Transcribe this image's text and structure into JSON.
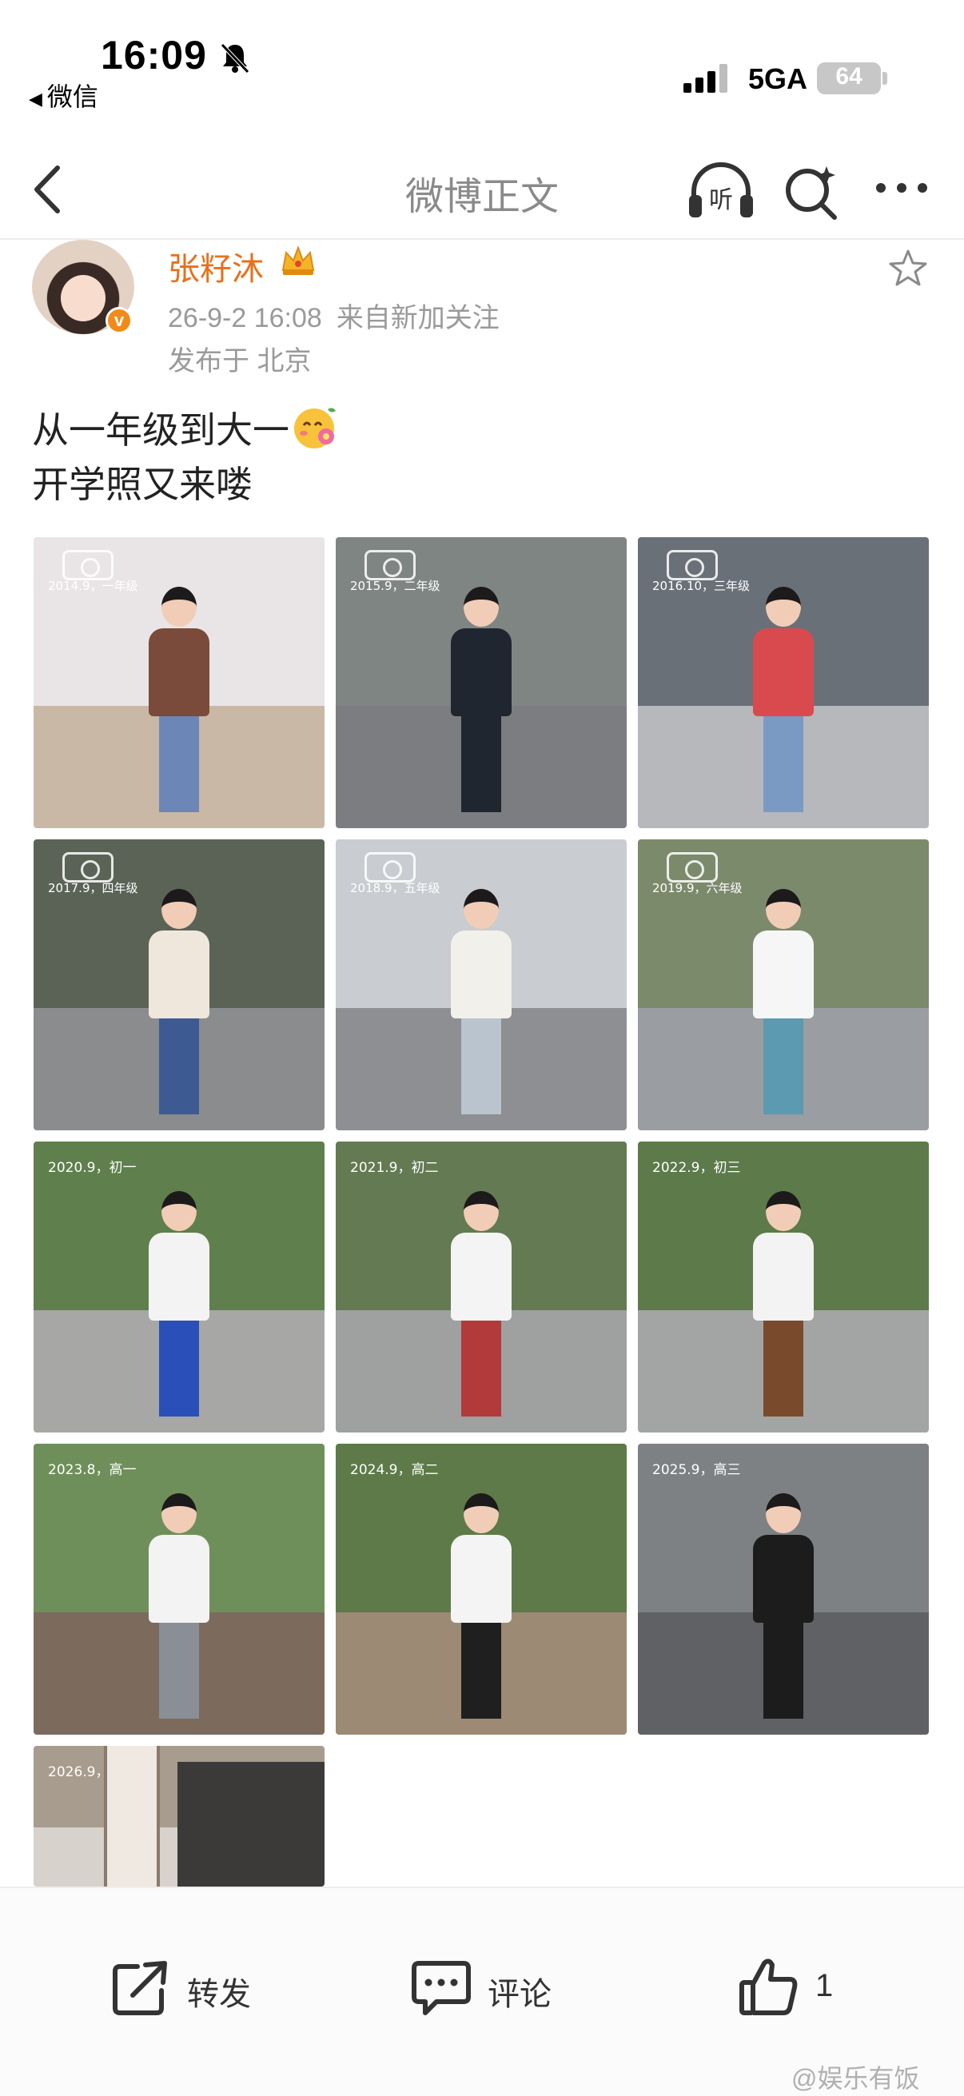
{
  "status_bar": {
    "time": "16:09",
    "back_app": "微信",
    "network": "5GA",
    "battery": "64"
  },
  "nav": {
    "title": "微博正文",
    "listen_icon_label": "听"
  },
  "post": {
    "username": "张籽沐",
    "timestamp": "26-9-2 16:08",
    "source": "来自新加关注",
    "location": "发布于 北京",
    "text_line1": "从一年级到大一",
    "text_line2": "开学照又来喽"
  },
  "photos": [
    {
      "caption": "2014.9，一年级",
      "sky": "#e9e4e6",
      "ground": "#c9b8a6",
      "top": "#7a4b3a",
      "bottom": "#6d86b8"
    },
    {
      "caption": "2015.9，二年级",
      "sky": "#7f8583",
      "ground": "#7b7d80",
      "top": "#1f2630",
      "bottom": "#1f2630"
    },
    {
      "caption": "2016.10，三年级",
      "sky": "#6a7078",
      "ground": "#b7b8bc",
      "top": "#d94a4f",
      "bottom": "#7a9ac4"
    },
    {
      "caption": "2017.9，四年级",
      "sky": "#5b6357",
      "ground": "#8a8c8e",
      "top": "#efe7dc",
      "bottom": "#3d5a92"
    },
    {
      "caption": "2018.9，五年级",
      "sky": "#c9ccd0",
      "ground": "#8d8f92",
      "top": "#f2f0ea",
      "bottom": "#b9c4cf"
    },
    {
      "caption": "2019.9，六年级",
      "sky": "#7c8a6c",
      "ground": "#9a9da1",
      "top": "#f6f6f6",
      "bottom": "#5b9ab0"
    },
    {
      "caption": "2020.9，初一",
      "sky": "#5f7f4c",
      "ground": "#a7a7a5",
      "top": "#f3f3f3",
      "bottom": "#2a4fb8"
    },
    {
      "caption": "2021.9，初二",
      "sky": "#637a52",
      "ground": "#9fa0a0",
      "top": "#f4f4f4",
      "bottom": "#b23a3a"
    },
    {
      "caption": "2022.9，初三",
      "sky": "#5c7a4a",
      "ground": "#a3a5a5",
      "top": "#f3f3f3",
      "bottom": "#7a4a2c"
    },
    {
      "caption": "2023.8，高一",
      "sky": "#6f8f5a",
      "ground": "#7c6a5c",
      "top": "#f3f3f3",
      "bottom": "#8a8e96"
    },
    {
      "caption": "2024.9，高二",
      "sky": "#5d7a48",
      "ground": "#9c8a74",
      "top": "#f4f4f4",
      "bottom": "#1f1f1f"
    },
    {
      "caption": "2025.9，高三",
      "sky": "#7e8184",
      "ground": "#5f6164",
      "top": "#1c1c1c",
      "bottom": "#1c1c1c"
    },
    {
      "caption": "2026.9，大一",
      "sky": "#a89c8e",
      "ground": "#d7d2cc",
      "top": "#d7d2cc",
      "bottom": "#d7d2cc"
    }
  ],
  "actions": {
    "repost_label": "转发",
    "comment_label": "评论",
    "like_count": "1"
  },
  "watermark": "@娱乐有饭",
  "colors": {
    "username": "#e8701a",
    "meta": "#9a9a9a",
    "title": "#8a8a8a"
  }
}
